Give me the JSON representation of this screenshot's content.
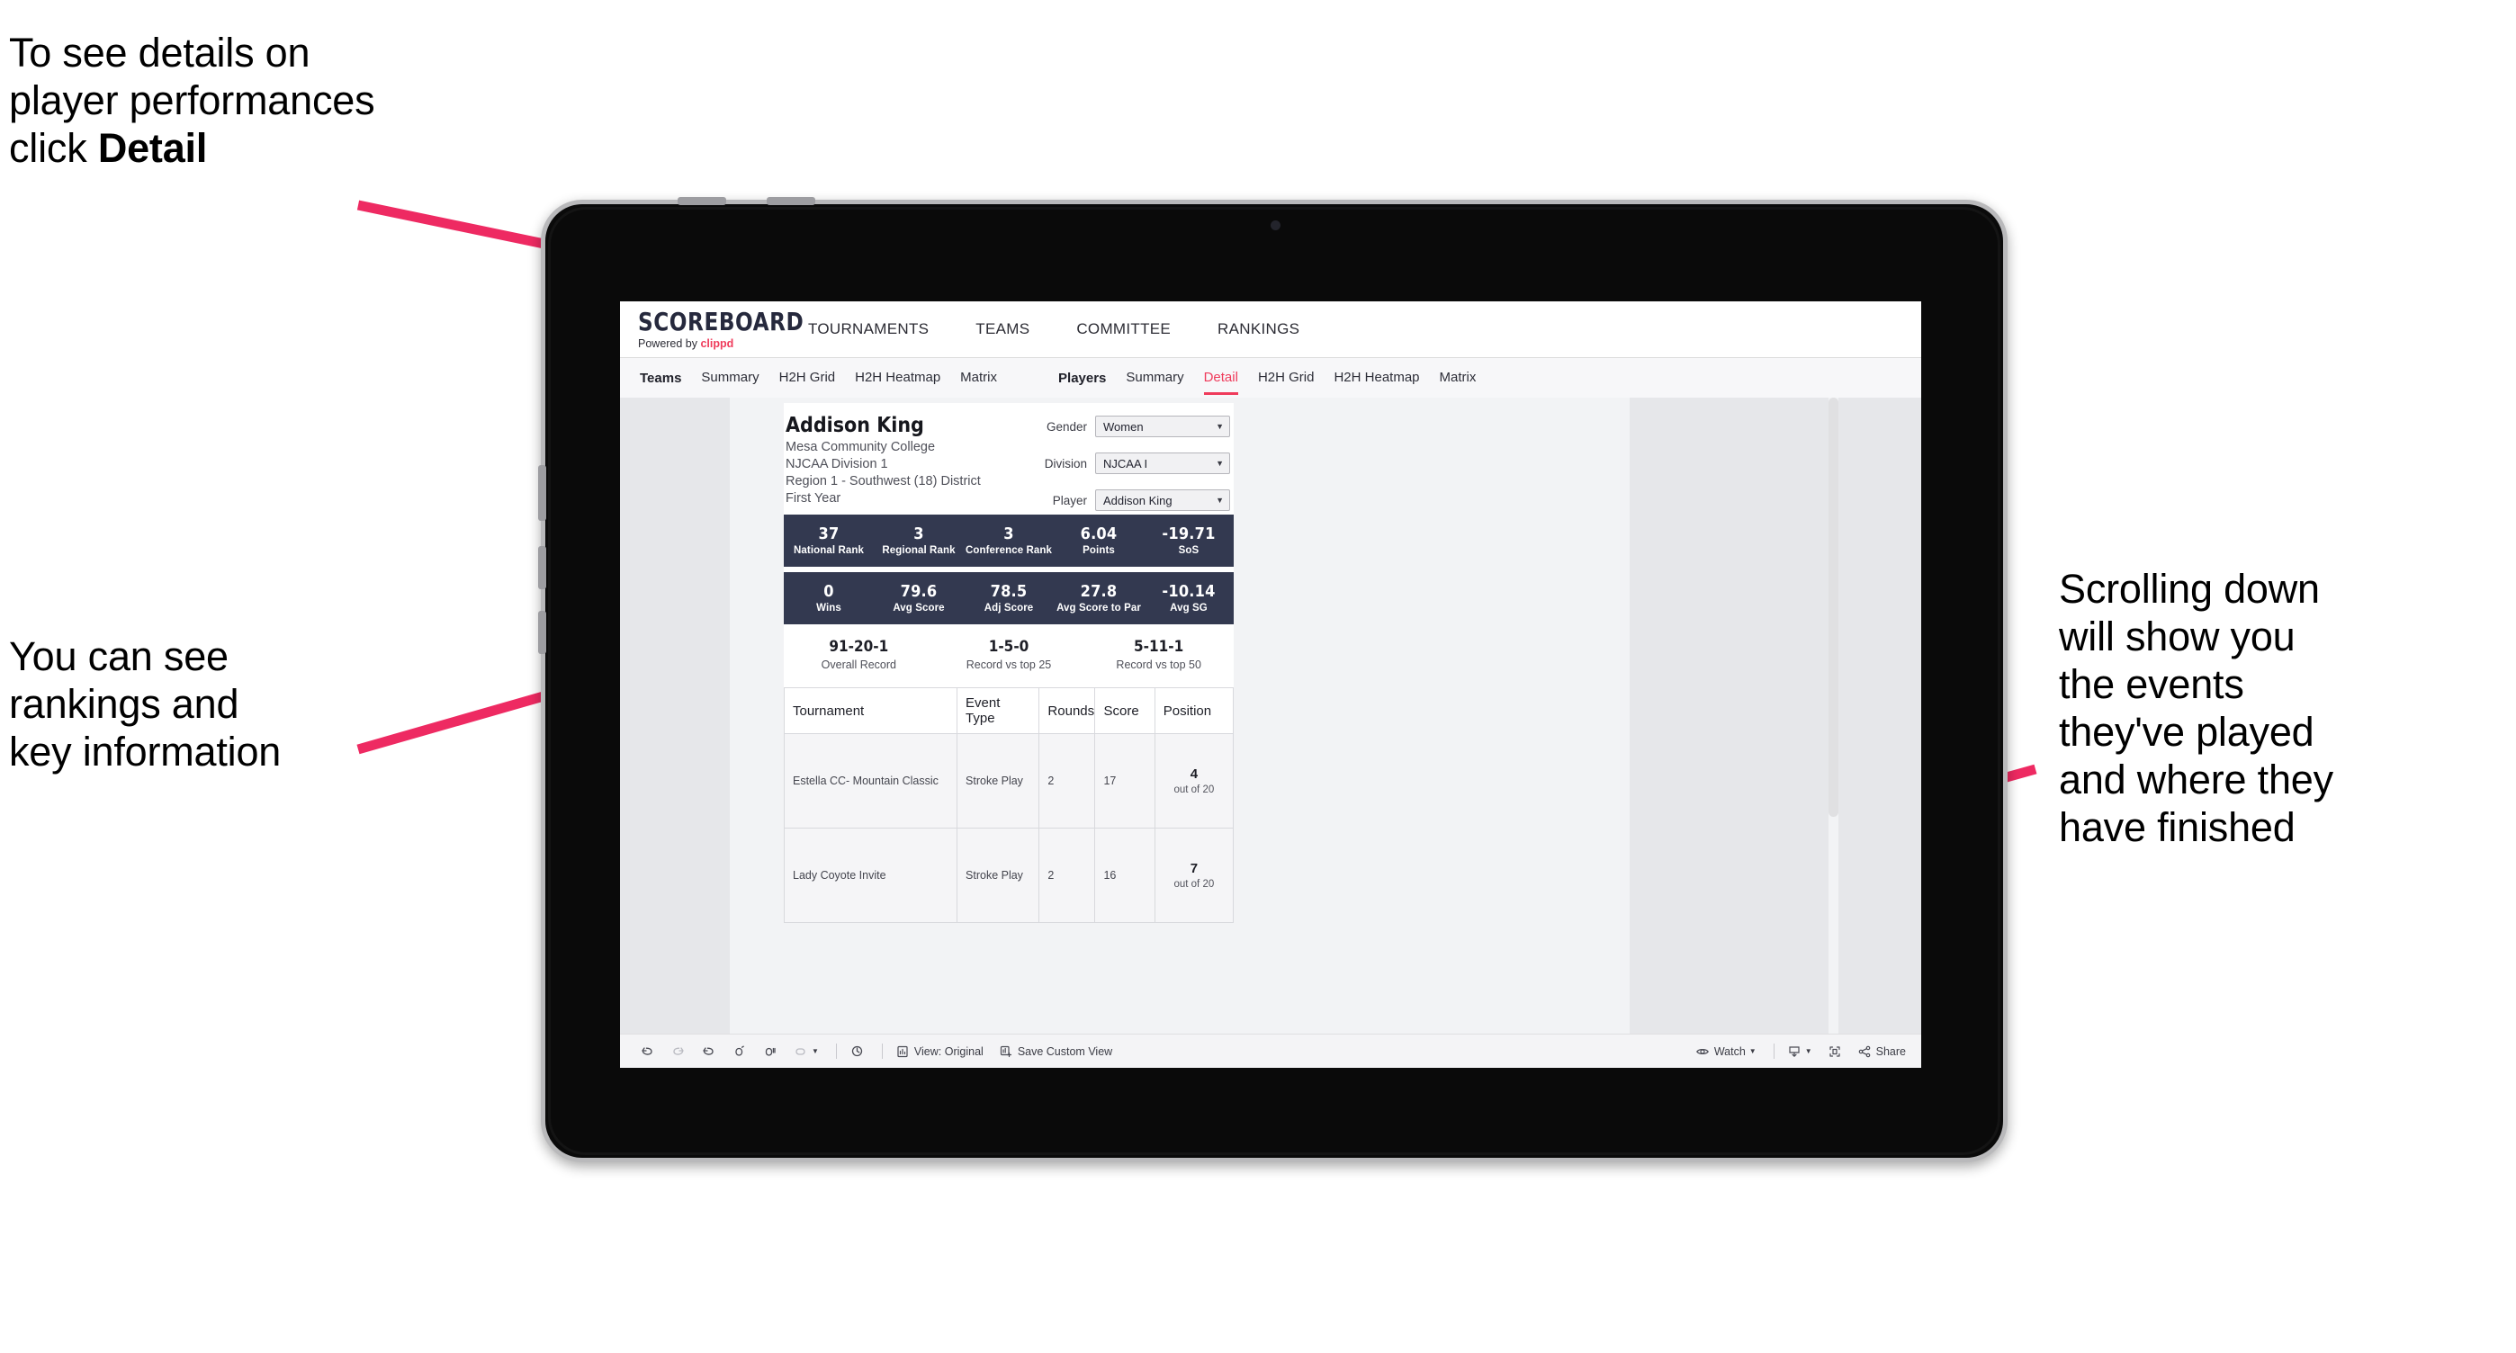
{
  "annotations": {
    "top_left": "To see details on\nplayer performances\nclick ",
    "top_left_bold": "Detail",
    "mid_left": "You can see\nrankings and\nkey information",
    "right": "Scrolling down\nwill show you\nthe events\nthey've played\nand where they\nhave finished"
  },
  "app": {
    "logo": {
      "word": "SCOREBOARD",
      "powered_prefix": "Powered by ",
      "brand": "clippd"
    },
    "topnav": [
      "TOURNAMENTS",
      "TEAMS",
      "COMMITTEE",
      "RANKINGS"
    ],
    "tabs_teams": {
      "lead": "Teams",
      "items": [
        "Summary",
        "H2H Grid",
        "H2H Heatmap",
        "Matrix"
      ]
    },
    "tabs_players": {
      "lead": "Players",
      "items": [
        "Summary",
        "Detail",
        "H2H Grid",
        "H2H Heatmap",
        "Matrix"
      ],
      "active": "Detail"
    },
    "player": {
      "name": "Addison King",
      "school": "Mesa Community College",
      "division": "NJCAA Division 1",
      "region": "Region 1 - Southwest (18) District",
      "year": "First Year"
    },
    "filters": [
      {
        "label": "Gender",
        "value": "Women"
      },
      {
        "label": "Division",
        "value": "NJCAA I"
      },
      {
        "label": "Player",
        "value": "Addison King"
      }
    ],
    "stats_row1": [
      {
        "value": "37",
        "label": "National Rank"
      },
      {
        "value": "3",
        "label": "Regional Rank"
      },
      {
        "value": "3",
        "label": "Conference Rank"
      },
      {
        "value": "6.04",
        "label": "Points"
      },
      {
        "value": "-19.71",
        "label": "SoS"
      }
    ],
    "stats_row2": [
      {
        "value": "0",
        "label": "Wins"
      },
      {
        "value": "79.6",
        "label": "Avg Score"
      },
      {
        "value": "78.5",
        "label": "Adj Score"
      },
      {
        "value": "27.8",
        "label": "Avg Score to Par"
      },
      {
        "value": "-10.14",
        "label": "Avg SG"
      }
    ],
    "records": [
      {
        "value": "91-20-1",
        "label": "Overall Record"
      },
      {
        "value": "1-5-0",
        "label": "Record vs top 25"
      },
      {
        "value": "5-11-1",
        "label": "Record vs top 50"
      }
    ],
    "table": {
      "columns": [
        "Tournament",
        "Event Type",
        "Rounds",
        "Score",
        "Position"
      ],
      "rows": [
        {
          "tournament": "Estella CC- Mountain Classic",
          "event_type": "Stroke Play",
          "rounds": "2",
          "score": "17",
          "position": "4",
          "position_out": "out of 20"
        },
        {
          "tournament": "Lady Coyote Invite",
          "event_type": "Stroke Play",
          "rounds": "2",
          "score": "16",
          "position": "7",
          "position_out": "out of 20"
        }
      ]
    },
    "toolbar": {
      "view_label": "View: Original",
      "save_label": "Save Custom View",
      "watch_label": "Watch",
      "share_label": "Share"
    }
  },
  "colors": {
    "accent_pink": "#ef3b5b",
    "navy_stat": "#333950",
    "arrow_pink": "#ee2a62"
  }
}
